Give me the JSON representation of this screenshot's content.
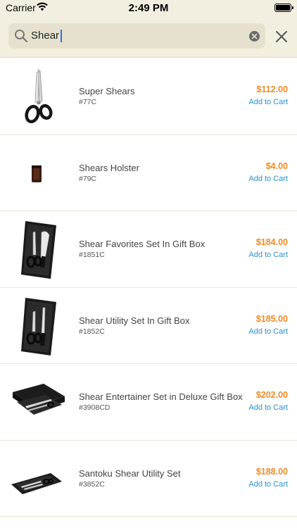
{
  "status_bar": {
    "carrier": "Carrier",
    "time": "2:49 PM"
  },
  "search": {
    "query": "Shear"
  },
  "products": [
    {
      "name": "Super Shears",
      "sku": "#77C",
      "price": "$112.00",
      "cart_label": "Add to Cart",
      "image": "shears"
    },
    {
      "name": "Shears Holster",
      "sku": "#79C",
      "price": "$4.00",
      "cart_label": "Add to Cart",
      "image": "holster"
    },
    {
      "name": "Shear Favorites Set In Gift Box",
      "sku": "#1851C",
      "price": "$184.00",
      "cart_label": "Add to Cart",
      "image": "gift-box-set"
    },
    {
      "name": "Shear Utility Set In Gift Box",
      "sku": "#1852C",
      "price": "$185.00",
      "cart_label": "Add to Cart",
      "image": "gift-box-set"
    },
    {
      "name": "Shear Entertainer Set in Deluxe Gift Box",
      "sku": "#3908CD",
      "price": "$202.00",
      "cart_label": "Add to Cart",
      "image": "deluxe-box"
    },
    {
      "name": "Santoku Shear Utility Set",
      "sku": "#3852C",
      "price": "$188.00",
      "cart_label": "Add to Cart",
      "image": "open-box"
    }
  ],
  "colors": {
    "header_bg": "#f3efe0",
    "price": "#f08a24",
    "link": "#2a8fd0",
    "caret": "#2f6fe0"
  }
}
